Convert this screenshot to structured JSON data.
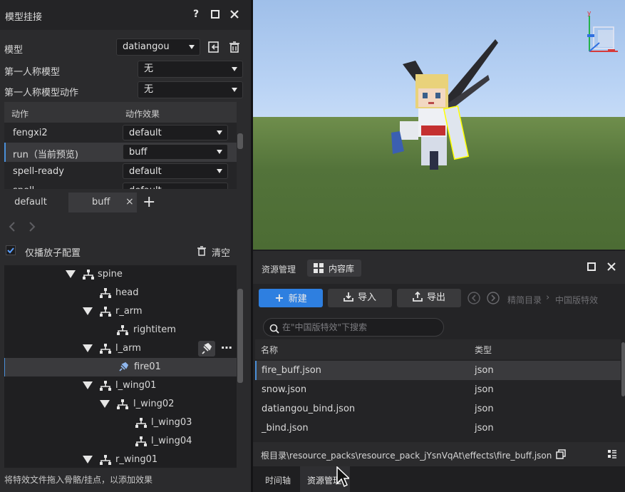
{
  "panel": {
    "title": "模型挂接",
    "help": "?",
    "model_label": "模型",
    "model_value": "datiangou",
    "fp_model_label": "第一人称模型",
    "fp_model_value": "无",
    "fp_anim_label": "第一人称模型动作",
    "fp_anim_value": "无"
  },
  "anim_table": {
    "col_action": "动作",
    "col_effect": "动作效果",
    "rows": [
      {
        "name": "fengxi2",
        "effect": "default"
      },
      {
        "name": "run（当前预览)",
        "effect": "buff"
      },
      {
        "name": "spell-ready",
        "effect": "default"
      },
      {
        "name": "spell",
        "effect": "default"
      }
    ]
  },
  "effect_tabs": {
    "tab1": "default",
    "tab2": "buff",
    "close": "×",
    "add": "+"
  },
  "only_play_label": "仅播放子配置",
  "clear_label": "清空",
  "tree": {
    "spine": "spine",
    "head": "head",
    "r_arm": "r_arm",
    "rightitem": "rightitem",
    "l_arm": "l_arm",
    "fire01": "fire01",
    "l_wing01": "l_wing01",
    "l_wing02": "l_wing02",
    "l_wing03": "l_wing03",
    "l_wing04": "l_wing04",
    "r_wing01": "r_wing01"
  },
  "status_left": "将特效文件拖入骨骼/挂点，以添加效果",
  "gizmo_axis": "y",
  "resource": {
    "tab_manage": "资源管理",
    "tab_content": "内容库",
    "btn_new": "新建",
    "btn_import": "导入",
    "btn_export": "导出",
    "crumb1": "精简目录",
    "crumb2": "中国版特效",
    "search_placeholder": "在\"中国版特效\"下搜索",
    "col_name": "名称",
    "col_type": "类型",
    "files": [
      {
        "name": "fire_buff.json",
        "type": "json"
      },
      {
        "name": "snow.json",
        "type": "json"
      },
      {
        "name": "datiangou_bind.json",
        "type": "json"
      },
      {
        "name": "_bind.json",
        "type": "json"
      }
    ],
    "path": "根目录\\resource_packs\\resource_pack_jYsnVqAt\\effects\\fire_buff.json",
    "bottom_tab1": "时间轴",
    "bottom_tab2": "资源管理"
  },
  "colors": {
    "accent": "#2e7fe0",
    "panel_bg": "#2b2b2d",
    "selection": "#3a3a3d"
  }
}
